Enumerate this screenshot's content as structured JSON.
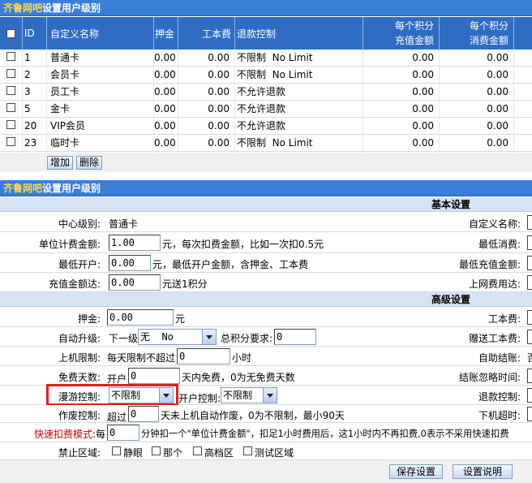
{
  "top": {
    "brand": "齐鲁网吧",
    "title": "设置用户级别"
  },
  "columns": {
    "id": "ID",
    "name": "自定义名称",
    "deposit": "押金",
    "cost": "工本费",
    "refund": "退款控制",
    "charge_a": "每个积分",
    "charge_b": "充值金额",
    "spend_a": "每个积分",
    "spend_b": "消费金额"
  },
  "rows": [
    {
      "id": "1",
      "name": "普通卡",
      "deposit": "0.00",
      "cost": "0.00",
      "refund": "不限制  No Limit",
      "charge": "0.00",
      "spend": "0.00"
    },
    {
      "id": "2",
      "name": "会员卡",
      "deposit": "0.00",
      "cost": "0.00",
      "refund": "不限制  No Limit",
      "charge": "0.00",
      "spend": "0.00"
    },
    {
      "id": "3",
      "name": "员工卡",
      "deposit": "0.00",
      "cost": "0.00",
      "refund": "不允许退款",
      "charge": "0.00",
      "spend": "0.00"
    },
    {
      "id": "5",
      "name": "金卡",
      "deposit": "0.00",
      "cost": "0.00",
      "refund": "不允许退款",
      "charge": "0.00",
      "spend": "0.00"
    },
    {
      "id": "20",
      "name": "VIP会员",
      "deposit": "0.00",
      "cost": "0.00",
      "refund": "不允许退款",
      "charge": "0.00",
      "spend": "0.00"
    },
    {
      "id": "23",
      "name": "临时卡",
      "deposit": "0.00",
      "cost": "0.00",
      "refund": "不限制  No Limit",
      "charge": "0.00",
      "spend": "0.00"
    }
  ],
  "buttons": {
    "add": "增加",
    "delete": "删除",
    "save": "保存设置",
    "help": "设置说明"
  },
  "form": {
    "basic": "基本设置",
    "advanced": "高级设置",
    "center_level": "中心级别:",
    "center_level_value": "普通卡",
    "unit_amount": "单位计费金额:",
    "unit_amount_value": "1.00",
    "unit_amount_note": "元，每次扣费金额，比如一次扣0.5元",
    "min_open": "最低开户:",
    "min_open_value": "0.00",
    "min_open_note": "元，最低开户金额，含押金、工本费",
    "recharge": "充值金额达:",
    "recharge_value": "0.00",
    "recharge_note": "元送1积分",
    "deposit": "押金:",
    "deposit_value": "0.00",
    "yuan": "元",
    "auto_up": "自动升级:",
    "next_level": "下一级",
    "next_level_value": "无  No",
    "total_points": "总积分要求:",
    "total_points_value": "0",
    "online_limit": "上机限制:",
    "online_limit_note": "每天限制不超过",
    "online_limit_value": "0",
    "hours": "小时",
    "free_days": "免费天数:",
    "open": "开户",
    "free_days_value": "0",
    "free_days_note": "天内免费，0为无免费天数",
    "roam": "漫游控制:",
    "roam_value": "不限制",
    "open_ctrl": "开户控制:",
    "open_ctrl_value": "不限制",
    "void_ctrl": "作废控制:",
    "exceed": "超过",
    "void_value": "0",
    "void_note": "天未上机自动作废，0为不限制，最小90天",
    "fast_mode": "快速扣费模式",
    "fast_each": ":每",
    "fast_value": "0",
    "fast_note": "分钟扣一个\"单位计费金额\"，扣足1小时费用后，这1小时内不再扣费,0表示不采用快速扣费",
    "forbid": "禁止区域:",
    "zones": [
      "静眼",
      "那个",
      "高档区",
      "测试区域"
    ],
    "r_custom": "自定义名称:",
    "r_min_spend": "最低消费:",
    "r_min_recharge": "最低充值金额:",
    "r_net_fee": "上网费用达:",
    "r_cost": "工本费:",
    "r_gift_cost": "赠送工本费:",
    "r_self_checkout": "自助结账:",
    "r_self_val": "否",
    "r_ignore_time": "结账忽略时间:",
    "r_refund": "退款控制:",
    "r_logout": "下机超时:"
  },
  "colors": {
    "header": "#2f6cc4",
    "highlight": "#e02020",
    "fast_mode": "#cc0000"
  }
}
